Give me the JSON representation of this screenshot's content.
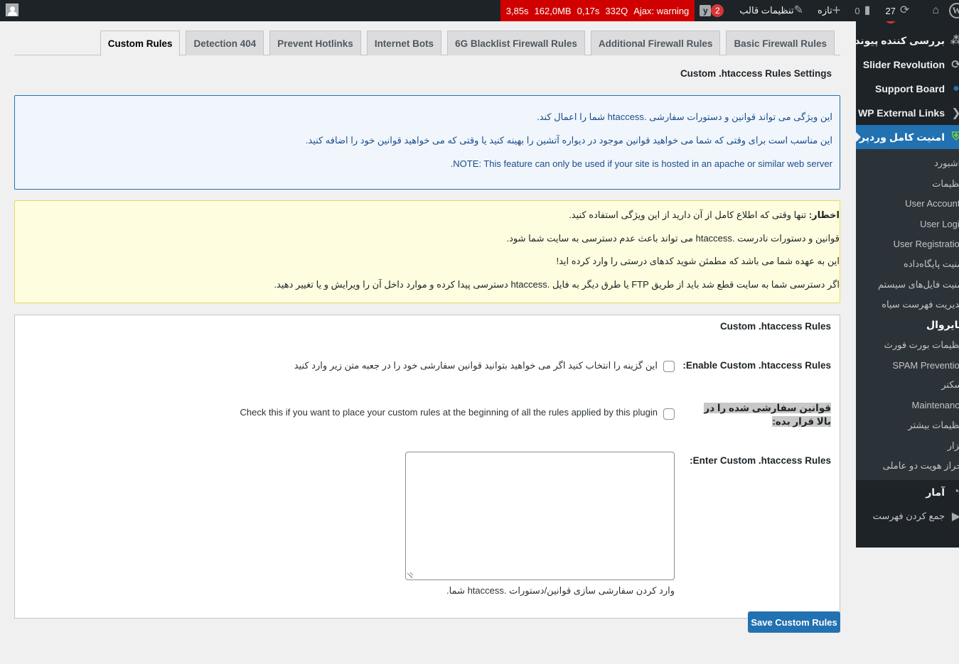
{
  "adminbar": {
    "perf": {
      "time": "3,85s",
      "memory": "162,0MB",
      "db_time": "0,17s",
      "queries": "332Q",
      "ajax": "Ajax: warning"
    },
    "yoast_badge": "2",
    "theme_settings": "تنظیمات قالب",
    "new": "تازه",
    "comments_count": "0",
    "updates_count": "27",
    "icons": {
      "home": "home-icon",
      "wp": "wordpress-logo-icon",
      "updates": "refresh-icon",
      "comments": "comment-icon",
      "new": "plus-icon",
      "customize": "brush-icon",
      "yoast": "yoast-icon",
      "avatar": "avatar-icon"
    }
  },
  "tabs": [
    {
      "label": "Custom Rules",
      "active": true
    },
    {
      "label": "Detection 404"
    },
    {
      "label": "Prevent Hotlinks"
    },
    {
      "label": "Internet Bots"
    },
    {
      "label": "6G Blacklist Firewall Rules"
    },
    {
      "label": "Additional Firewall Rules"
    },
    {
      "label": "Basic Firewall Rules"
    }
  ],
  "section_title": "Custom .htaccess Rules Settings",
  "info_notice": [
    "این ویژگی می تواند قوانین و دستورات سفارشی .htaccess شما را اعمال کند.",
    "این مناسب است برای وقتی که شما می خواهید قوانین موجود در دیواره آتشین را بهینه کنید یا وقتی که می خواهید قوانین خود را اضافه کنید.",
    "NOTE: This feature can only be used if your site is hosted in an apache or similar web server."
  ],
  "warning_notice": {
    "label": "اخطار:",
    "lines": [
      "تنها وقتی که اطلاع کامل از آن دارید از این ویژگی استفاده کنید.",
      "قوانین و دستورات نادرست .htaccess می تواند باعث عدم دسترسی به سایت شما شود.",
      "این به عهده شما می باشد که مطمئن شوید کدهای درستی را وارد کرده اید!",
      "اگر دسترسی شما به سایت قطع شد باید از طریق FTP یا طرق دیگر به فایل .htaccess دسترسی پیدا کرده و موارد داخل آن را ویرایش و یا تغییر دهید."
    ]
  },
  "panel": {
    "title": "Custom .htaccess Rules",
    "enable_label": "Enable Custom .htaccess Rules:",
    "enable_desc": "این گزینه را انتخاب کنید اگر می خواهید بتوانید قوانین سفارشی خود را در جعبه متن زیر وارد کنید",
    "enable_checked": false,
    "top_label": "قوانین سفارشی شده را در بالا قرار بده:",
    "top_desc": "Check this if you want to place your custom rules at the beginning of all the rules applied by this plugin",
    "top_checked": false,
    "rules_label": "Enter Custom .htaccess Rules:",
    "rules_value": "",
    "rules_desc": "وارد کردن سفارشی سازی قوانین/دستورات .htaccess شما."
  },
  "save_button": "Save Custom Rules",
  "sidebar": {
    "menu_top": [
      {
        "label": "بررسی کننده پیوند",
        "icon": "link-checker-icon"
      },
      {
        "label": "Slider Revolution",
        "icon": "slider-revolution-icon"
      },
      {
        "label": "Support Board",
        "icon": "chat-bubble-icon"
      },
      {
        "label": "WP External Links",
        "icon": "external-links-icon"
      },
      {
        "label": "امنیت کامل وردپرس",
        "icon": "shield-icon",
        "active": true
      }
    ],
    "submenu": [
      {
        "label": "داشبورد"
      },
      {
        "label": "تنظیمات"
      },
      {
        "label": "User Accounts"
      },
      {
        "label": "User Login"
      },
      {
        "label": "User Registration"
      },
      {
        "label": "امنیت پایگاه‌داده"
      },
      {
        "label": "امنیت فایل‌های سیستم"
      },
      {
        "label": "مدیریت فهرست سیاه"
      },
      {
        "label": "فایروال",
        "current": true
      },
      {
        "label": "تنظیمات بورت فورث"
      },
      {
        "label": "SPAM Prevention"
      },
      {
        "label": "اسکنر"
      },
      {
        "label": "Maintenance"
      },
      {
        "label": "تنظیمات بیشتر"
      },
      {
        "label": "ابزار"
      },
      {
        "label": "احراز هویت دو عاملی"
      }
    ],
    "menu_bottom": [
      {
        "label": "آمار",
        "icon": "stats-icon"
      },
      {
        "label": "جمع کردن فهرست",
        "icon": "collapse-icon"
      }
    ]
  }
}
